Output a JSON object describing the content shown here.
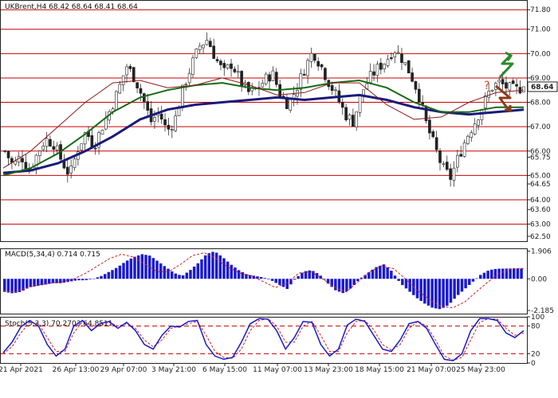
{
  "chart_data": [
    {
      "type": "candlestick",
      "title": "UKBrent,H4  68.42 68.64 68.41 68.64",
      "symbol": "UKBrent,H4",
      "ohlc_last": [
        68.42,
        68.64,
        68.41,
        68.64
      ],
      "current_price": "68.64",
      "ylim": [
        62.3,
        72.2
      ],
      "y_ticks": [
        {
          "label": "71.80",
          "v": 71.8,
          "level": true
        },
        {
          "label": "71.00",
          "v": 71.0,
          "level": true
        },
        {
          "label": "70.00",
          "v": 70.0,
          "level": true
        },
        {
          "label": "69.00",
          "v": 69.0,
          "level": true
        },
        {
          "label": "68.00",
          "v": 68.0,
          "level": true
        },
        {
          "label": "67.00",
          "v": 67.0,
          "level": true
        },
        {
          "label": "66.00",
          "v": 66.0,
          "level": true
        },
        {
          "label": "65.75",
          "v": 65.75,
          "level": false
        },
        {
          "label": "65.00",
          "v": 65.0,
          "level": true
        },
        {
          "label": "64.65",
          "v": 64.65,
          "level": false
        },
        {
          "label": "64.00",
          "v": 64.0,
          "level": true
        },
        {
          "label": "63.60",
          "v": 63.6,
          "level": false
        },
        {
          "label": "63.00",
          "v": 63.0,
          "level": true
        },
        {
          "label": "62.50",
          "v": 62.5,
          "level": false
        }
      ],
      "series_path": [
        66.0,
        65.4,
        65.8,
        65.2,
        65.9,
        66.5,
        66.3,
        65.6,
        65.0,
        66.1,
        66.8,
        66.2,
        67.0,
        67.7,
        68.5,
        69.5,
        69.0,
        68.2,
        67.2,
        67.6,
        66.8,
        67.3,
        68.6,
        69.5,
        70.3,
        70.6,
        69.8,
        69.2,
        69.6,
        68.9,
        68.4,
        68.5,
        68.9,
        69.2,
        68.3,
        67.9,
        68.6,
        69.4,
        70.1,
        69.5,
        68.8,
        68.2,
        67.5,
        67.2,
        68.4,
        69.0,
        69.4,
        69.7,
        70.2,
        69.8,
        69.2,
        68.4,
        67.1,
        66.2,
        65.3,
        64.9,
        65.8,
        66.6,
        67.2,
        67.9,
        68.6,
        68.8,
        68.6,
        68.5,
        68.64
      ],
      "ma_red": [
        65.3,
        66.0,
        67.0,
        68.0,
        68.8,
        68.9,
        68.6,
        68.7,
        69.0,
        68.7,
        68.3,
        68.4,
        68.8,
        68.8,
        67.9,
        67.3,
        67.4,
        68.0,
        68.4,
        68.5
      ],
      "ma_green": [
        65.0,
        65.3,
        65.9,
        66.7,
        67.6,
        68.2,
        68.5,
        68.7,
        68.8,
        68.6,
        68.5,
        68.6,
        68.8,
        68.9,
        68.6,
        68.0,
        67.6,
        67.6,
        67.8,
        67.8
      ],
      "ma_navy": [
        65.1,
        65.2,
        65.5,
        66.0,
        66.6,
        67.3,
        67.7,
        67.9,
        68.0,
        68.1,
        68.2,
        68.1,
        68.2,
        68.3,
        68.1,
        67.8,
        67.6,
        67.5,
        67.6,
        67.7
      ],
      "annotation": "?",
      "x_labels": [
        "21 Apr 2021",
        "26 Apr 13:00",
        "29 Apr 07:00",
        "3 May 21:00",
        "6 May 15:00",
        "11 May 07:00",
        "13 May 23:00",
        "18 May 15:00",
        "21 May 07:00",
        "25 May 23:00"
      ],
      "colors": {
        "up": "#1a9a2a",
        "down": "#8b1e1e",
        "level": "#cc0000",
        "ma_red": "#8b1a1a",
        "ma_green": "#156b15",
        "ma_navy": "#1a1a7a"
      }
    },
    {
      "type": "histogram",
      "title": "MACD(5,34,4) 0.714 0.715",
      "ylim": [
        -2.4,
        2.1
      ],
      "y_ticks": [
        {
          "label": "1.906",
          "v": 1.906
        },
        {
          "label": "0.00",
          "v": 0.0
        },
        {
          "label": "-2.185",
          "v": -2.185
        }
      ],
      "values": [
        -0.9,
        -1.0,
        -0.9,
        -0.6,
        -0.5,
        -0.4,
        -0.3,
        -0.3,
        -0.2,
        -0.1,
        -0.1,
        0.0,
        0.2,
        0.5,
        0.8,
        1.2,
        1.5,
        1.7,
        1.6,
        1.2,
        0.8,
        0.4,
        0.2,
        0.6,
        1.1,
        1.7,
        1.9,
        1.5,
        1.0,
        0.6,
        0.3,
        0.2,
        0.1,
        -0.1,
        -0.4,
        -0.7,
        0.0,
        0.5,
        0.6,
        0.3,
        -0.3,
        -0.8,
        -1.0,
        -0.6,
        0.0,
        0.4,
        0.8,
        1.0,
        0.5,
        -0.3,
        -0.8,
        -1.3,
        -1.7,
        -2.0,
        -2.1,
        -1.8,
        -1.2,
        -0.7,
        -0.2,
        0.3,
        0.6,
        0.7,
        0.7,
        0.72,
        0.714
      ],
      "signal": [
        -0.8,
        -0.9,
        -0.6,
        -0.4,
        -0.3,
        -0.2,
        0.0,
        0.4,
        0.9,
        1.4,
        1.7,
        1.5,
        1.0,
        0.5,
        0.5,
        1.0,
        1.6,
        1.8,
        1.4,
        0.8,
        0.4,
        0.2,
        -0.2,
        -0.6,
        -0.3,
        0.4,
        0.5,
        0.0,
        -0.6,
        -0.9,
        -0.2,
        0.5,
        0.9,
        0.7,
        0.0,
        -0.8,
        -1.4,
        -1.9,
        -2.0,
        -1.6,
        -0.9,
        -0.2,
        0.4,
        0.7,
        0.715
      ],
      "colors": {
        "bar": "#1a1acc",
        "signal": "#cc2222"
      }
    },
    {
      "type": "line",
      "title": "Stoch(5,3,3) 70.2703 64.8511",
      "ylim": [
        0,
        100
      ],
      "y_ticks": [
        {
          "label": "100",
          "v": 100
        },
        {
          "label": "80",
          "v": 80
        },
        {
          "label": "20",
          "v": 20
        },
        {
          "label": "0",
          "v": 0
        }
      ],
      "levels": [
        80,
        20
      ],
      "k": [
        22,
        45,
        78,
        92,
        80,
        40,
        15,
        30,
        80,
        92,
        70,
        85,
        90,
        75,
        88,
        70,
        40,
        30,
        60,
        80,
        78,
        90,
        92,
        40,
        15,
        8,
        12,
        45,
        85,
        96,
        95,
        70,
        30,
        55,
        90,
        88,
        40,
        15,
        30,
        82,
        95,
        90,
        60,
        30,
        25,
        50,
        85,
        90,
        75,
        40,
        8,
        5,
        20,
        70,
        96,
        96,
        92,
        65,
        55,
        70
      ],
      "d": [
        20,
        35,
        65,
        88,
        85,
        55,
        25,
        25,
        65,
        90,
        80,
        80,
        88,
        80,
        85,
        75,
        50,
        35,
        50,
        75,
        80,
        85,
        90,
        60,
        25,
        12,
        10,
        30,
        70,
        92,
        96,
        80,
        45,
        45,
        80,
        90,
        60,
        25,
        25,
        65,
        90,
        92,
        72,
        40,
        28,
        40,
        75,
        90,
        80,
        50,
        15,
        6,
        12,
        50,
        88,
        96,
        95,
        75,
        60,
        64.85
      ],
      "colors": {
        "k": "#1a1acc",
        "d": "#cc2222",
        "level": "#cc0000"
      }
    }
  ]
}
